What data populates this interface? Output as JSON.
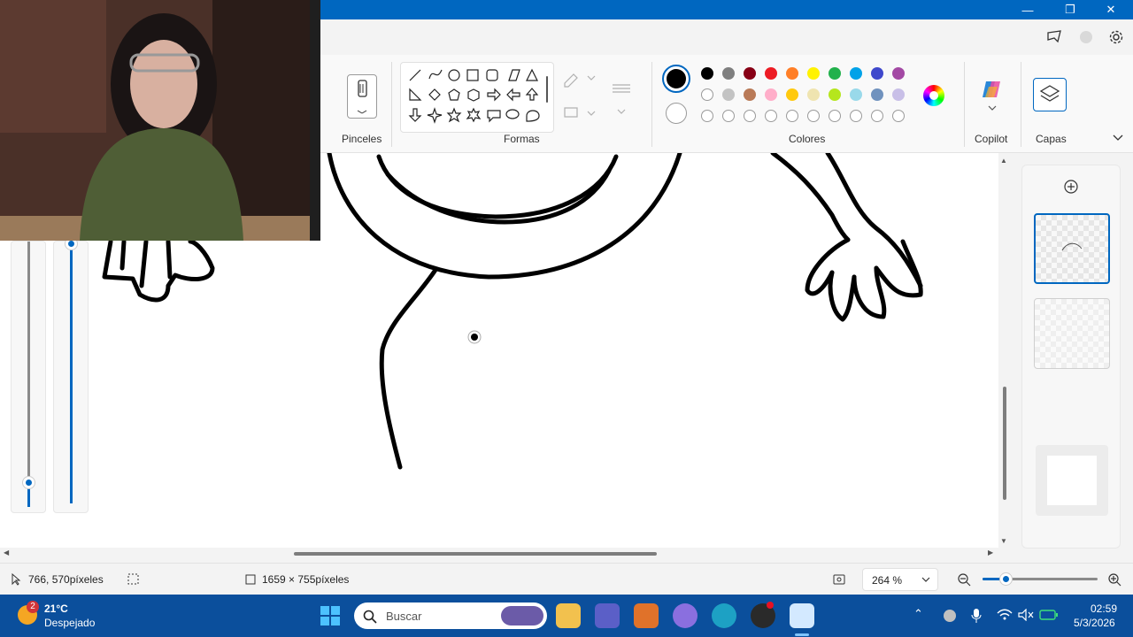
{
  "window": {
    "controls": {
      "minimize": "—",
      "maximize": "❐",
      "close": "✕"
    }
  },
  "ribbon": {
    "brushes_label": "Pinceles",
    "shapes_label": "Formas",
    "colors_label": "Colores",
    "copilot_label": "Copilot",
    "layers_label": "Capas",
    "primary_color": "#000000",
    "secondary_color": "#ffffff",
    "palette_row1": [
      "#000000",
      "#7f7f7f",
      "#880015",
      "#ed1c24",
      "#ff7f27",
      "#fff200",
      "#22b14c",
      "#00a2e8",
      "#3f48cc",
      "#a349a4"
    ],
    "palette_row2": [
      "#ffffff",
      "#c3c3c3",
      "#b97a57",
      "#ffaec9",
      "#ffc90e",
      "#efe4b0",
      "#b5e61d",
      "#99d9ea",
      "#7092be",
      "#c8bfe7"
    ],
    "palette_row3_count": 10
  },
  "status": {
    "cursor_position": "766, 570píxeles",
    "canvas_size": "1659 × 755píxeles",
    "zoom": "264 %",
    "zoom_level": 0.2
  },
  "taskbar": {
    "weather_temp": "21°C",
    "weather_desc": "Despejado",
    "weather_badge": "2",
    "search_placeholder": "Buscar",
    "time": "02:59",
    "date": "5/3/2026"
  },
  "icons": {
    "brush": "brush-icon",
    "layers": "layers-icon",
    "copilot": "copilot-icon",
    "settings": "gear-icon",
    "share": "share-icon",
    "add_layer": "plus-icon"
  }
}
